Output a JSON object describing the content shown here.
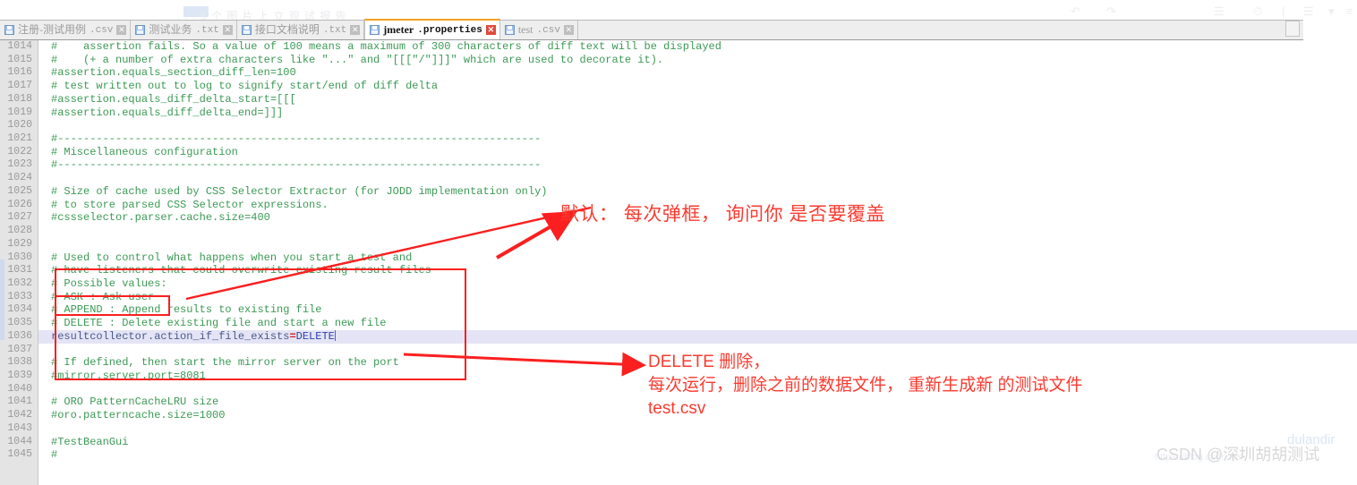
{
  "window": {
    "ghost_toolbar_text": ". . . 5  个 图 片 上 立 观 试 报 告",
    "ghost_icons": [
      "list-icon",
      "clock-icon",
      "divider-icon",
      "lines-icon",
      "chevron-down-icon",
      "indent-icon"
    ]
  },
  "tabs": [
    {
      "name": "注册-测试用例",
      "ext": ".csv",
      "active": false,
      "close": "✕",
      "icon": "save-icon"
    },
    {
      "name": "测试业务",
      "ext": ".txt",
      "active": false,
      "close": "✕",
      "icon": "save-icon"
    },
    {
      "name": "接口文档说明",
      "ext": ".txt",
      "active": false,
      "close": "✕",
      "icon": "save-icon"
    },
    {
      "name": "jmeter",
      "ext": ".properties",
      "active": true,
      "close": "✕",
      "icon": "save-icon"
    },
    {
      "name": "test",
      "ext": ".csv",
      "active": false,
      "close": "✕",
      "icon": "save-icon"
    }
  ],
  "editor": {
    "first_line_number": 1014,
    "active_line_number": 1036,
    "lines": [
      {
        "n": "1014",
        "text": "#    assertion fails. So a value of 100 means a maximum of 300 characters of diff text will be displayed"
      },
      {
        "n": "1015",
        "text": "#    (+ a number of extra characters like \"...\" and \"[[[\"/\"]]]\" which are used to decorate it)."
      },
      {
        "n": "1016",
        "text": "#assertion.equals_section_diff_len=100"
      },
      {
        "n": "1017",
        "text": "# test written out to log to signify start/end of diff delta"
      },
      {
        "n": "1018",
        "text": "#assertion.equals_diff_delta_start=[[["
      },
      {
        "n": "1019",
        "text": "#assertion.equals_diff_delta_end=]]]"
      },
      {
        "n": "1020",
        "text": ""
      },
      {
        "n": "1021",
        "text": "#---------------------------------------------------------------------------"
      },
      {
        "n": "1022",
        "text": "# Miscellaneous configuration"
      },
      {
        "n": "1023",
        "text": "#---------------------------------------------------------------------------"
      },
      {
        "n": "1024",
        "text": ""
      },
      {
        "n": "1025",
        "text": "# Size of cache used by CSS Selector Extractor (for JODD implementation only)"
      },
      {
        "n": "1026",
        "text": "# to store parsed CSS Selector expressions."
      },
      {
        "n": "1027",
        "text": "#cssselector.parser.cache.size=400"
      },
      {
        "n": "1028",
        "text": ""
      },
      {
        "n": "1029",
        "text": ""
      },
      {
        "n": "1030",
        "text": "# Used to control what happens when you start a test and"
      },
      {
        "n": "1031",
        "text": "# have listeners that could overwrite existing result files"
      },
      {
        "n": "1032",
        "text": "# Possible values:"
      },
      {
        "n": "1033",
        "text": "# ASK : Ask user"
      },
      {
        "n": "1034",
        "text": "# APPEND : Append results to existing file"
      },
      {
        "n": "1035",
        "text": "# DELETE : Delete existing file and start a new file"
      },
      {
        "n": "1036",
        "text": "resultcollector.action_if_file_exists=DELETE",
        "active": true,
        "key": "resultcollector.action_if_file_exists",
        "eq": "=",
        "value": "DELETE"
      },
      {
        "n": "1037",
        "text": ""
      },
      {
        "n": "1038",
        "text": "# If defined, then start the mirror server on the port"
      },
      {
        "n": "1039",
        "text": "#mirror.server.port=8081"
      },
      {
        "n": "1040",
        "text": ""
      },
      {
        "n": "1041",
        "text": "# ORO PatternCacheLRU size"
      },
      {
        "n": "1042",
        "text": "#oro.patterncache.size=1000"
      },
      {
        "n": "1043",
        "text": ""
      },
      {
        "n": "1044",
        "text": "#TestBeanGui"
      },
      {
        "n": "1045",
        "text": "#"
      }
    ]
  },
  "annotations": {
    "color": "#fb3b30",
    "note_default": "默认： 每次弹框， 询问你 是否要覆盖",
    "note_delete_line1": "DELETE 删除，",
    "note_delete_line2": "每次运行，删除之前的数据文件， 重新生成新 的测试文件",
    "note_delete_line3": "test.csv"
  },
  "watermark": {
    "main": "CSDN @深圳胡胡测试",
    "sub": "dulandir",
    "url": "https://blog.csdn.net"
  }
}
